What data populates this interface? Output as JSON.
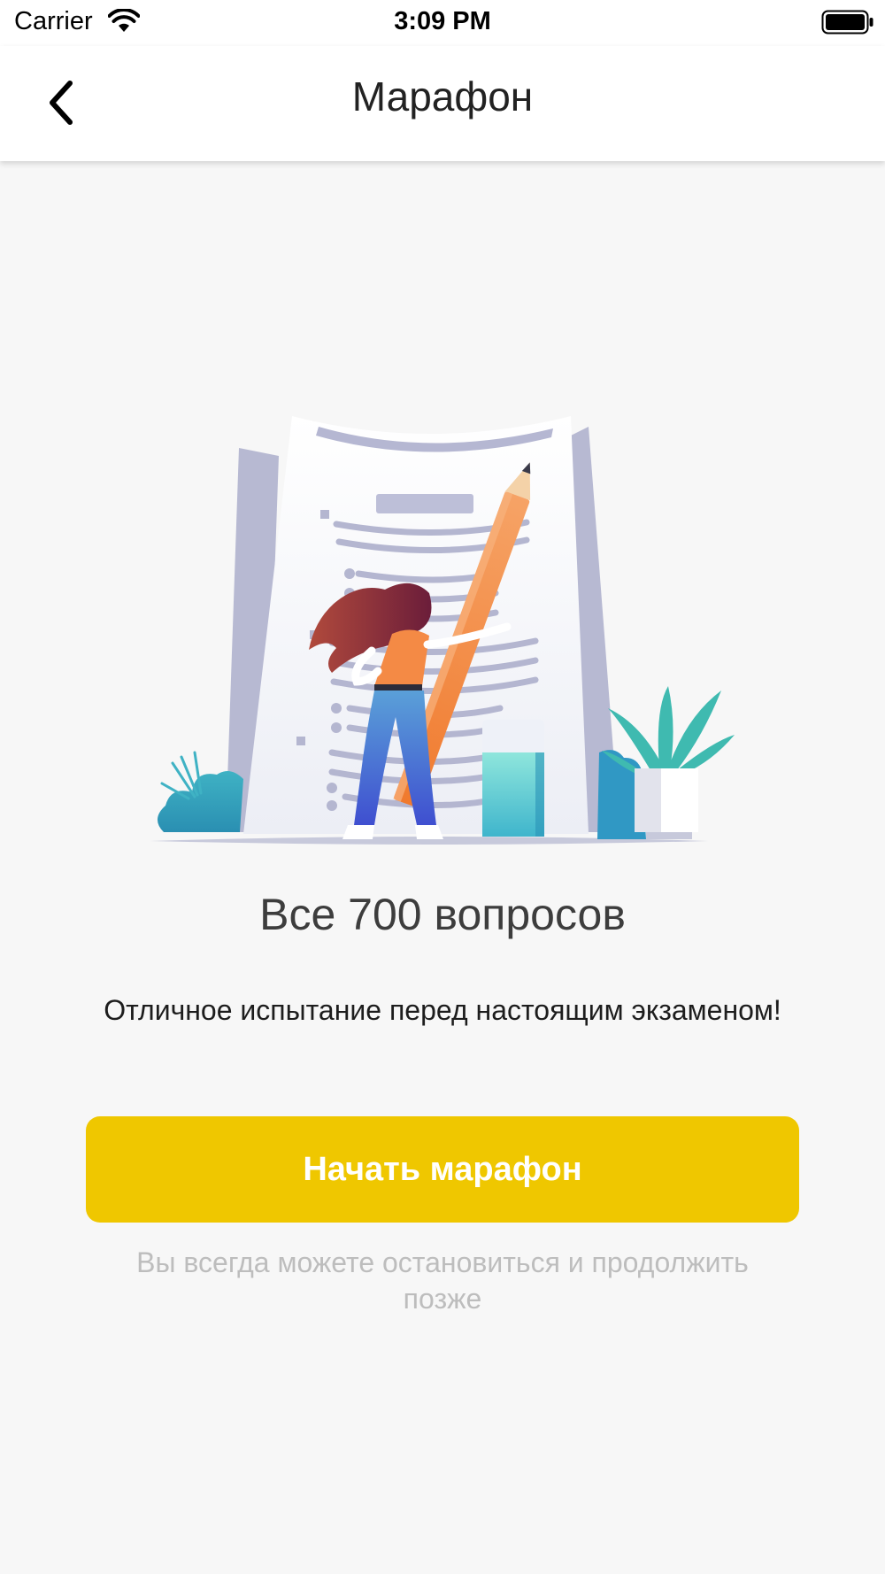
{
  "status_bar": {
    "carrier": "Carrier",
    "time": "3:09 PM",
    "wifi_icon": "wifi-icon",
    "battery_icon": "battery-icon"
  },
  "nav": {
    "title": "Марафон",
    "back_icon": "chevron-left-icon"
  },
  "content": {
    "illustration": "document-checklist-illustration",
    "headline": "Все 700 вопросов",
    "subtitle": "Отличное испытание перед настоящим экзаменом!",
    "start_button_label": "Начать марафон",
    "hint": "Вы всегда можете остановиться и продолжить позже"
  },
  "colors": {
    "accent": "#efc700",
    "background": "#f7f7f7",
    "hint_text": "#bdbdbd"
  }
}
